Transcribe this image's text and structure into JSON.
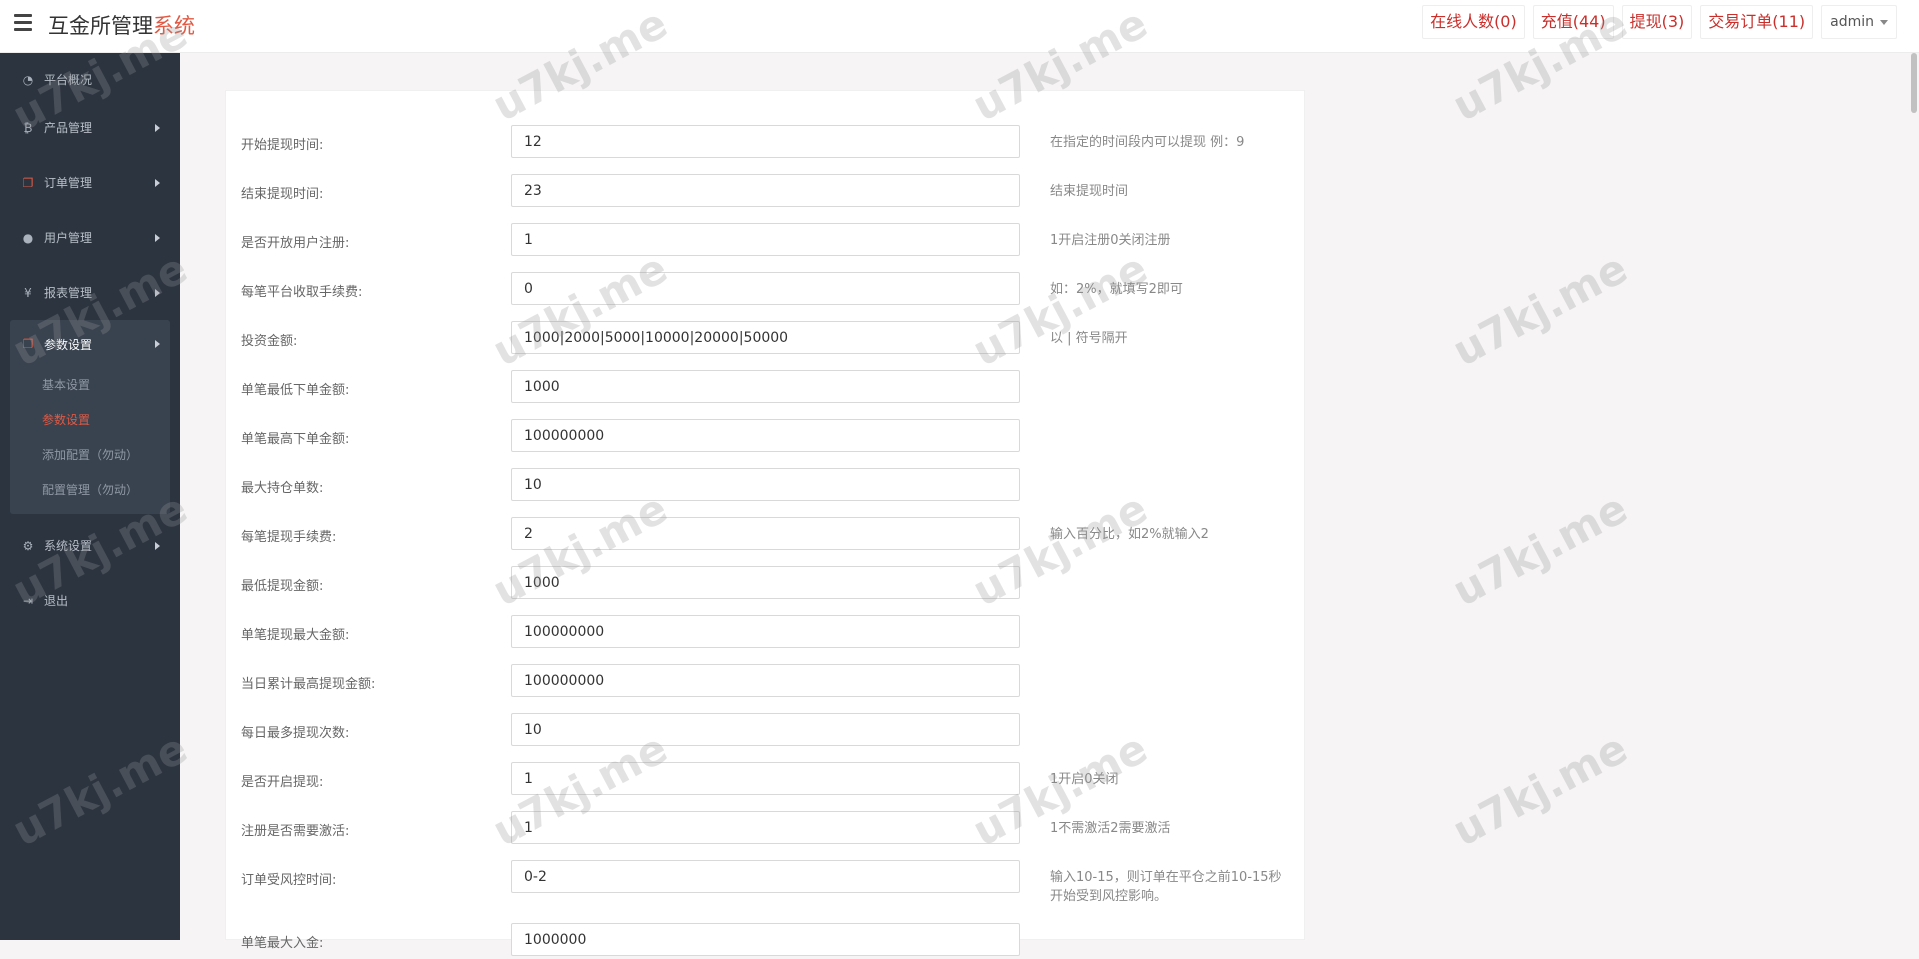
{
  "header": {
    "brand_main": "互金所管理",
    "brand_accent": "系统",
    "links": [
      {
        "label": "在线人数(0)"
      },
      {
        "label": "充值(44)"
      },
      {
        "label": "提现(3)"
      },
      {
        "label": "交易订单(11)"
      }
    ],
    "user": "admin"
  },
  "sidebar": {
    "items": [
      {
        "label": "平台概况",
        "icon": "dashboard-icon"
      },
      {
        "label": "产品管理",
        "icon": "bitcoin-icon"
      },
      {
        "label": "订单管理",
        "icon": "copy-icon"
      },
      {
        "label": "用户管理",
        "icon": "user-icon"
      },
      {
        "label": "报表管理",
        "icon": "yen-icon"
      }
    ],
    "active_group": {
      "label": "参数设置",
      "icon": "copy-icon",
      "subitems": [
        {
          "label": "基本设置"
        },
        {
          "label": "参数设置"
        },
        {
          "label": "添加配置（勿动）"
        },
        {
          "label": "配置管理（勿动）"
        }
      ]
    },
    "bottom_items": [
      {
        "label": "系统设置",
        "icon": "cogs-icon"
      },
      {
        "label": "退出",
        "icon": "sign-out-icon"
      }
    ]
  },
  "form": {
    "rows": [
      {
        "label": "开始提现时间:",
        "value": "12",
        "help": "在指定的时间段内可以提现 例：9"
      },
      {
        "label": "结束提现时间:",
        "value": "23",
        "help": "结束提现时间"
      },
      {
        "label": "是否开放用户注册:",
        "value": "1",
        "help": "1开启注册0关闭注册"
      },
      {
        "label": "每笔平台收取手续费:",
        "value": "0",
        "help": "如：2%，就填写2即可"
      },
      {
        "label": "投资金额:",
        "value": "1000|2000|5000|10000|20000|50000",
        "help": "以 | 符号隔开"
      },
      {
        "label": "单笔最低下单金额:",
        "value": "1000",
        "help": ""
      },
      {
        "label": "单笔最高下单金额:",
        "value": "100000000",
        "help": ""
      },
      {
        "label": "最大持仓单数:",
        "value": "10",
        "help": ""
      },
      {
        "label": "每笔提现手续费:",
        "value": "2",
        "help": "输入百分比，如2%就输入2"
      },
      {
        "label": "最低提现金额:",
        "value": "1000",
        "help": ""
      },
      {
        "label": "单笔提现最大金额:",
        "value": "100000000",
        "help": ""
      },
      {
        "label": "当日累计最高提现金额:",
        "value": "100000000",
        "help": ""
      },
      {
        "label": "每日最多提现次数:",
        "value": "10",
        "help": ""
      },
      {
        "label": "是否开启提现:",
        "value": "1",
        "help": "1开启0关闭"
      },
      {
        "label": "注册是否需要激活:",
        "value": "1",
        "help": "1不需激活2需要激活"
      },
      {
        "label": "订单受风控时间:",
        "value": "0-2",
        "help": "输入10-15，则订单在平仓之前10-15秒开始受到风控影响。"
      },
      {
        "label": "单笔最大入金:",
        "value": "1000000",
        "help": ""
      }
    ]
  },
  "watermark": "u7kj.me",
  "colors": {
    "accent": "#e05a45",
    "link": "#c9302c",
    "sidebar": "#2c3440"
  }
}
